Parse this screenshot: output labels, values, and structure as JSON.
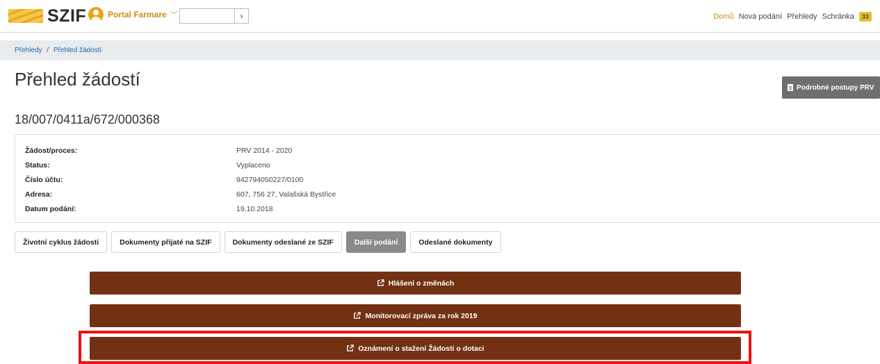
{
  "header": {
    "logo_text": "SZIF",
    "portal_label": "Portal Farmare",
    "search_button": "›",
    "nav": [
      "Domů",
      "Nová podání",
      "Přehledy",
      "Schránka"
    ],
    "inbox_count": "33",
    "active_color": "#c98e12"
  },
  "breadcrumb": {
    "items": [
      "Přehledy",
      "Přehled žádostí"
    ],
    "separator": "/"
  },
  "page": {
    "title": "Přehled žádostí",
    "prv_button": "Podrobné postupy PRV",
    "case_id": "18/007/0411a/672/000368"
  },
  "info": {
    "rows": [
      {
        "label": "Žádost/proces:",
        "value": "PRV 2014 - 2020"
      },
      {
        "label": "Status:",
        "value": "Vyplaceno"
      },
      {
        "label": "Číslo účtu:",
        "value": "942794050227/0100"
      },
      {
        "label": "Adresa:",
        "value": "607, 756 27, Valašská Bystřice"
      },
      {
        "label": "Datum podání:",
        "value": "19.10.2018"
      }
    ]
  },
  "tabs": [
    {
      "label": "Životní cyklus žádosti",
      "active": false
    },
    {
      "label": "Dokumenty přijaté na SZIF",
      "active": false
    },
    {
      "label": "Dokumenty odeslané ze SZIF",
      "active": false
    },
    {
      "label": "Další podání",
      "active": true
    },
    {
      "label": "Odeslané dokumenty",
      "active": false
    }
  ],
  "actions": [
    {
      "label": "Hlášení o změnách",
      "icon": "external-link-icon"
    },
    {
      "label": "Monitorovací zpráva za rok 2019",
      "icon": "external-link-icon"
    },
    {
      "label": "Oznámení o stažení Žádosti o dotaci",
      "icon": "external-link-icon"
    }
  ],
  "colors": {
    "action_bg": "#733113",
    "highlight": "#f01010",
    "active_tab": "#8a8a8a"
  }
}
